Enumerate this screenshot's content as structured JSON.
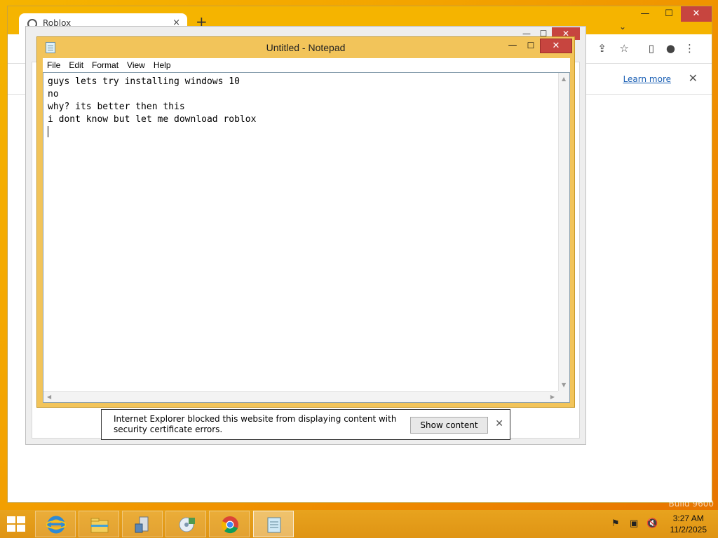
{
  "chrome": {
    "tab_title": "Roblox",
    "tab_close": "×",
    "new_tab": "+",
    "chevron": "⌄",
    "learn_more": "Learn more",
    "infobar_close": "✕",
    "min": "—",
    "max": "☐",
    "close": "✕"
  },
  "ie": {
    "notification_text": "Internet Explorer blocked this website from displaying content with security certificate errors.",
    "show_content_label": "Show content",
    "close": "✕",
    "min": "—",
    "max": "☐"
  },
  "notepad": {
    "title": "Untitled - Notepad",
    "min": "—",
    "max": "☐",
    "close": "✕",
    "menu": [
      "File",
      "Edit",
      "Format",
      "View",
      "Help"
    ],
    "text": "guys lets try installing windows 10\nno\nwhy? its better then this\ni dont know but let me download roblox"
  },
  "taskbar": {
    "apps": [
      "internet-explorer-icon",
      "file-explorer-icon",
      "computer-icon",
      "media-center-icon",
      "chrome-icon",
      "notepad-icon"
    ],
    "time": "3:27 AM",
    "date": "11/2/2025"
  },
  "watermark": "Build 9600",
  "colors": {
    "accent": "#f5b400",
    "close_red": "#c7453f",
    "link": "#1a5fb4"
  }
}
